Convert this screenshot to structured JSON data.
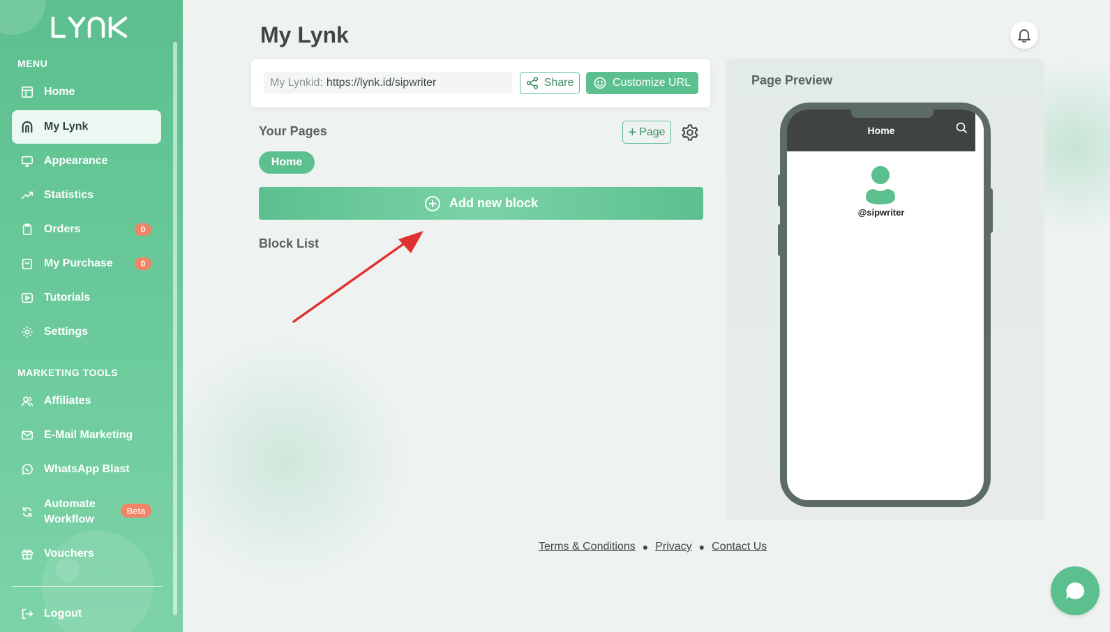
{
  "app": {
    "logo_text": "LYNK"
  },
  "sidebar": {
    "menu_label": "MENU",
    "marketing_label": "MARKETING TOOLS",
    "items": [
      {
        "label": "Home",
        "icon": "home-icon"
      },
      {
        "label": "My Lynk",
        "icon": "lynk-icon",
        "active": true
      },
      {
        "label": "Appearance",
        "icon": "monitor-icon"
      },
      {
        "label": "Statistics",
        "icon": "chart-line-icon"
      },
      {
        "label": "Orders",
        "icon": "clipboard-icon",
        "badge": "0"
      },
      {
        "label": "My Purchase",
        "icon": "bag-icon",
        "badge": "0"
      },
      {
        "label": "Tutorials",
        "icon": "play-icon"
      },
      {
        "label": "Settings",
        "icon": "gear-icon"
      }
    ],
    "marketing_items": [
      {
        "label": "Affiliates",
        "icon": "users-icon"
      },
      {
        "label": "E-Mail Marketing",
        "icon": "mail-icon"
      },
      {
        "label": "WhatsApp Blast",
        "icon": "whatsapp-icon"
      },
      {
        "label_line1": "Automate",
        "label_line2": "Workflow",
        "icon": "refresh-icon",
        "badge": "Beta"
      },
      {
        "label": "Vouchers",
        "icon": "gift-icon"
      }
    ],
    "logout_label": "Logout"
  },
  "main": {
    "title": "My Lynk",
    "lynkid_label": "My Lynkid:",
    "lynkid_value": "https://lynk.id/sipwriter",
    "share_label": "Share",
    "customize_label": "Customize URL",
    "your_pages_label": "Your Pages",
    "add_page_label": "Page",
    "page_chip": "Home",
    "add_block_label": "Add new block",
    "block_list_label": "Block List"
  },
  "preview": {
    "title": "Page Preview",
    "screen_title": "Home",
    "username": "@sipwriter"
  },
  "footer": {
    "terms": "Terms & Conditions",
    "privacy": "Privacy",
    "contact": "Contact Us"
  },
  "colors": {
    "brand": "#5cbf8e",
    "badge": "#f08469",
    "arrow": "#e03131"
  }
}
